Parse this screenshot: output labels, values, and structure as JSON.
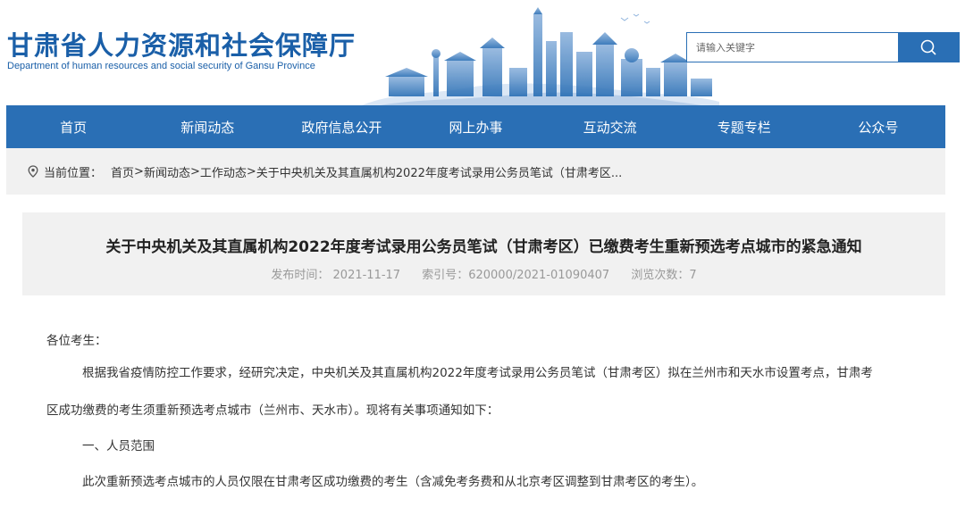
{
  "header": {
    "title": "甘肃省人力资源和社会保障厅",
    "subtitle": "Department of human resources and social security of Gansu Province",
    "brand_color": "#2a6fb5"
  },
  "search": {
    "placeholder": "请输入关键字",
    "icon": "search-icon"
  },
  "nav": {
    "items": [
      "首页",
      "新闻动态",
      "政府信息公开",
      "网上办事",
      "互动交流",
      "专题专栏",
      "公众号"
    ]
  },
  "breadcrumb": {
    "icon": "location-pin-icon",
    "label": "当前位置：",
    "items": [
      "首页",
      "新闻动态",
      "工作动态",
      "关于中央机关及其直属机构2022年度考试录用公务员笔试（甘肃考区..."
    ],
    "separators": [
      ">",
      ">",
      " >"
    ]
  },
  "article": {
    "title": "关于中央机关及其直属机构2022年度考试录用公务员笔试（甘肃考区）已缴费考生重新预选考点城市的紧急通知",
    "publish_time": "发布时间：  2021-11-17",
    "index_no": "索引号：620000/2021-01090407",
    "views": "浏览次数：7",
    "paragraphs": {
      "greeting": "各位考生：",
      "body1": "根据我省疫情防控工作要求，经研究决定，中央机关及其直属机构2022年度考试录用公务员笔试（甘肃考区）拟在兰州市和天水市设置考点，甘肃考",
      "body2": "区成功缴费的考生须重新预选考点城市（兰州市、天水市）。现将有关事项通知如下：",
      "section1": "一、人员范围",
      "body3": "此次重新预选考点城市的人员仅限在甘肃考区成功缴费的考生（含减免考务费和从北京考区调整到甘肃考区的考生）。"
    }
  }
}
